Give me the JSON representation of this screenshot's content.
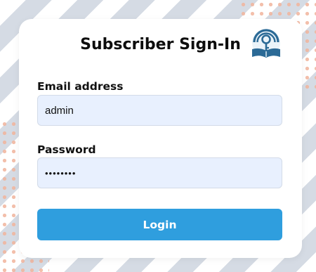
{
  "login_form": {
    "title": "Subscriber Sign-In",
    "email_label": "Email address",
    "email_value": "admin",
    "password_label": "Password",
    "password_value": "password",
    "login_button": "Login"
  },
  "logo_icon": "key-book-icon",
  "colors": {
    "button": "#2f9ede",
    "input_background": "#e8f0fe",
    "logo": "#2b6a96"
  }
}
